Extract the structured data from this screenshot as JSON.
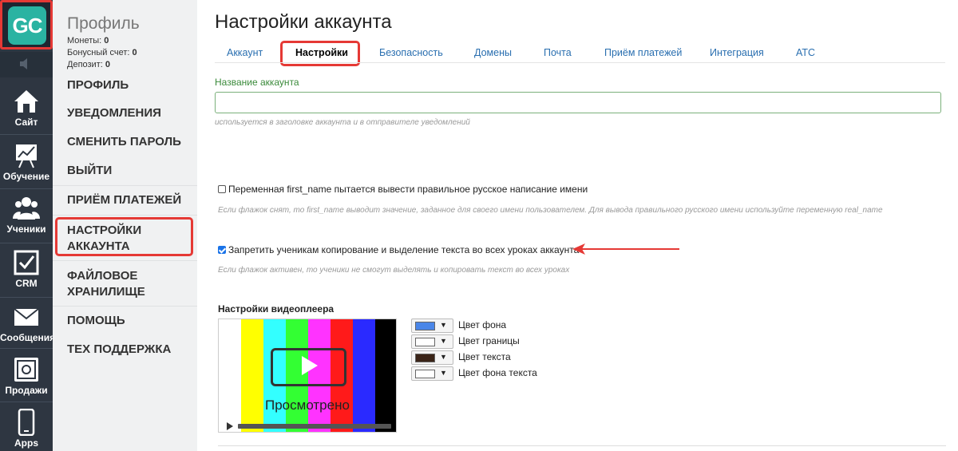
{
  "rail": {
    "items": [
      {
        "label": "Сайт",
        "icon": "house-icon"
      },
      {
        "label": "Обучение",
        "icon": "chart-board-icon"
      },
      {
        "label": "Ученики",
        "icon": "users-icon"
      },
      {
        "label": "CRM",
        "icon": "checkbox-icon"
      },
      {
        "label": "Сообщения",
        "icon": "envelope-icon"
      },
      {
        "label": "Продажи",
        "icon": "safe-icon"
      },
      {
        "label": "Apps",
        "icon": "phone-icon"
      }
    ],
    "logo_text": "GC",
    "colors": {
      "bg": "#2e3641",
      "logo": "#2ab3a2",
      "highlight": "#e53935"
    }
  },
  "sidebar": {
    "title": "Профиль",
    "coins_label": "Монеты:",
    "coins_value": "0",
    "bonus_label": "Бонусный счет:",
    "bonus_value": "0",
    "deposit_label": "Депозит:",
    "deposit_value": "0",
    "menu": [
      {
        "label": "ПРОФИЛЬ"
      },
      {
        "label": "УВЕДОМЛЕНИЯ"
      },
      {
        "label": "СМЕНИТЬ ПАРОЛЬ"
      },
      {
        "label": "ВЫЙТИ"
      },
      {
        "label": "ПРИЁМ ПЛАТЕЖЕЙ"
      },
      {
        "label_1": "НАСТРОЙКИ",
        "label_2": "АККАУНТА"
      },
      {
        "label_1": "ФАЙЛОВОЕ",
        "label_2": "ХРАНИЛИЩЕ"
      },
      {
        "label": "ПОМОЩЬ"
      },
      {
        "label": "ТЕХ ПОДДЕРЖКА"
      }
    ]
  },
  "main": {
    "title": "Настройки аккаунта",
    "tabs": [
      {
        "label": "Аккаунт"
      },
      {
        "label": "Настройки",
        "active": true
      },
      {
        "label": "Безопасность"
      },
      {
        "label": "Домены"
      },
      {
        "label": "Почта"
      },
      {
        "label": "Приём платежей"
      },
      {
        "label": "Интеграция"
      },
      {
        "label": "АТС"
      }
    ],
    "account_name": {
      "label": "Название аккаунта",
      "value": "",
      "hint": "используется в заголовке аккаунта и в отправителе уведомлений"
    },
    "first_name_option": {
      "checked": false,
      "label": "Переменная first_name пытается вывести правильное русское написание имени",
      "hint": "Если флажок снят, то first_name выводит значение, заданное для своего имени пользователем. Для вывода правильного русского имени используйте переменную real_name"
    },
    "copy_protect_option": {
      "checked": true,
      "label": "Запретить ученикам копирование и выделение текста во всех уроках аккаунта",
      "hint": "Если флажок активен, то ученики не смогут выделять и копировать текст во всех уроках"
    },
    "video_player": {
      "title": "Настройки видеоплеера",
      "preview_text": "Просмотрено",
      "bar_colors": [
        "#ffffff",
        "#ffff00",
        "#33ffff",
        "#33ff33",
        "#ff33ff",
        "#ff1a1a",
        "#2a2aff",
        "#000000"
      ],
      "swatches": [
        {
          "label": "Цвет фона",
          "color": "#4a86e8"
        },
        {
          "label": "Цвет границы",
          "color": "#ffffff"
        },
        {
          "label": "Цвет текста",
          "color": "#3a2418"
        },
        {
          "label": "Цвет фона текста",
          "color": "#ffffff"
        }
      ]
    }
  }
}
